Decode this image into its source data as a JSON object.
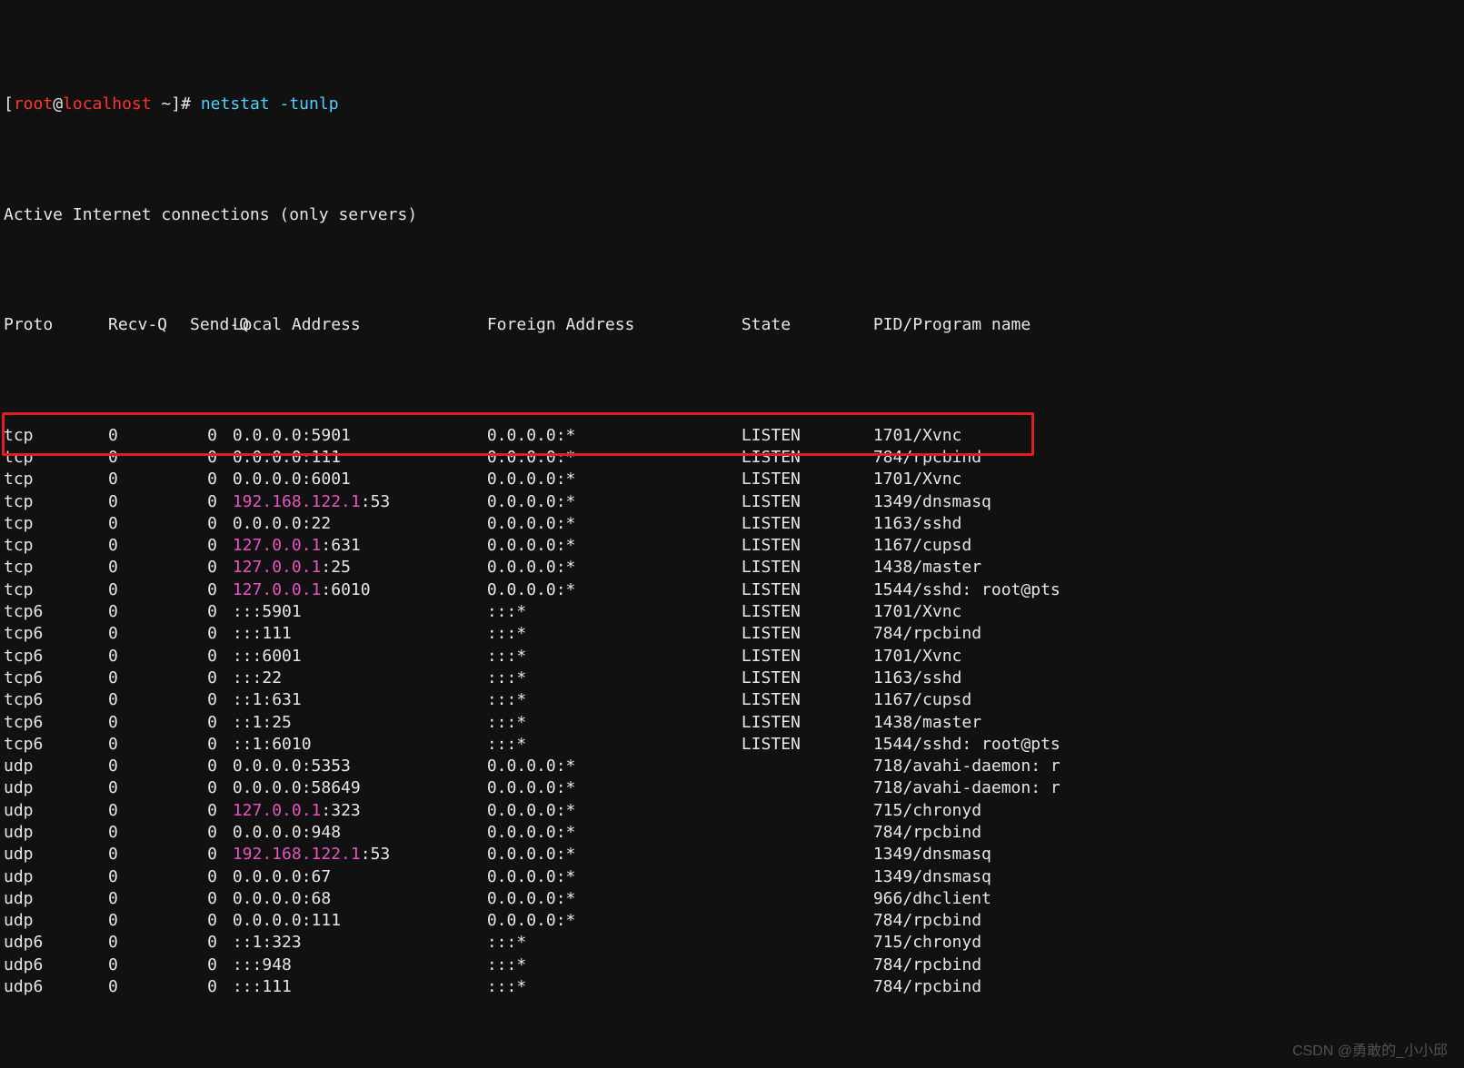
{
  "prompt": {
    "open": "[",
    "user": "root",
    "at": "@",
    "host": "localhost",
    "path": " ~",
    "close": "]#",
    "command": "netstat -tunlp"
  },
  "title_line": "Active Internet connections (only servers)",
  "headers": {
    "proto": "Proto",
    "recvq": "Recv-Q",
    "sendq": "Send-Q",
    "local": "Local Address",
    "foreign": "Foreign Address",
    "state": "State",
    "pid": "PID/Program name"
  },
  "rows": [
    {
      "proto": "tcp",
      "recvq": "0",
      "sendq": "0",
      "local_pre": "",
      "local_hi": "",
      "local_post": "0.0.0.0:5901",
      "foreign": "0.0.0.0:*",
      "state": "LISTEN",
      "pid": "1701/Xvnc",
      "hl": true
    },
    {
      "proto": "tcp",
      "recvq": "0",
      "sendq": "0",
      "local_pre": "",
      "local_hi": "",
      "local_post": "0.0.0.0:111",
      "foreign": "0.0.0.0:*",
      "state": "LISTEN",
      "pid": "784/rpcbind"
    },
    {
      "proto": "tcp",
      "recvq": "0",
      "sendq": "0",
      "local_pre": "",
      "local_hi": "",
      "local_post": "0.0.0.0:6001",
      "foreign": "0.0.0.0:*",
      "state": "LISTEN",
      "pid": "1701/Xvnc"
    },
    {
      "proto": "tcp",
      "recvq": "0",
      "sendq": "0",
      "local_pre": "",
      "local_hi": "192.168.122.1",
      "local_post": ":53",
      "foreign": "0.0.0.0:*",
      "state": "LISTEN",
      "pid": "1349/dnsmasq"
    },
    {
      "proto": "tcp",
      "recvq": "0",
      "sendq": "0",
      "local_pre": "",
      "local_hi": "",
      "local_post": "0.0.0.0:22",
      "foreign": "0.0.0.0:*",
      "state": "LISTEN",
      "pid": "1163/sshd"
    },
    {
      "proto": "tcp",
      "recvq": "0",
      "sendq": "0",
      "local_pre": "",
      "local_hi": "127.0.0.1",
      "local_post": ":631",
      "foreign": "0.0.0.0:*",
      "state": "LISTEN",
      "pid": "1167/cupsd"
    },
    {
      "proto": "tcp",
      "recvq": "0",
      "sendq": "0",
      "local_pre": "",
      "local_hi": "127.0.0.1",
      "local_post": ":25",
      "foreign": "0.0.0.0:*",
      "state": "LISTEN",
      "pid": "1438/master"
    },
    {
      "proto": "tcp",
      "recvq": "0",
      "sendq": "0",
      "local_pre": "",
      "local_hi": "127.0.0.1",
      "local_post": ":6010",
      "foreign": "0.0.0.0:*",
      "state": "LISTEN",
      "pid": "1544/sshd: root@pts"
    },
    {
      "proto": "tcp6",
      "recvq": "0",
      "sendq": "0",
      "local_pre": "",
      "local_hi": "",
      "local_post": ":::5901",
      "foreign": ":::*",
      "state": "LISTEN",
      "pid": "1701/Xvnc"
    },
    {
      "proto": "tcp6",
      "recvq": "0",
      "sendq": "0",
      "local_pre": "",
      "local_hi": "",
      "local_post": ":::111",
      "foreign": ":::*",
      "state": "LISTEN",
      "pid": "784/rpcbind"
    },
    {
      "proto": "tcp6",
      "recvq": "0",
      "sendq": "0",
      "local_pre": "",
      "local_hi": "",
      "local_post": ":::6001",
      "foreign": ":::*",
      "state": "LISTEN",
      "pid": "1701/Xvnc"
    },
    {
      "proto": "tcp6",
      "recvq": "0",
      "sendq": "0",
      "local_pre": "",
      "local_hi": "",
      "local_post": ":::22",
      "foreign": ":::*",
      "state": "LISTEN",
      "pid": "1163/sshd"
    },
    {
      "proto": "tcp6",
      "recvq": "0",
      "sendq": "0",
      "local_pre": "",
      "local_hi": "",
      "local_post": "::1:631",
      "foreign": ":::*",
      "state": "LISTEN",
      "pid": "1167/cupsd"
    },
    {
      "proto": "tcp6",
      "recvq": "0",
      "sendq": "0",
      "local_pre": "",
      "local_hi": "",
      "local_post": "::1:25",
      "foreign": ":::*",
      "state": "LISTEN",
      "pid": "1438/master"
    },
    {
      "proto": "tcp6",
      "recvq": "0",
      "sendq": "0",
      "local_pre": "",
      "local_hi": "",
      "local_post": "::1:6010",
      "foreign": ":::*",
      "state": "LISTEN",
      "pid": "1544/sshd: root@pts"
    },
    {
      "proto": "udp",
      "recvq": "0",
      "sendq": "0",
      "local_pre": "",
      "local_hi": "",
      "local_post": "0.0.0.0:5353",
      "foreign": "0.0.0.0:*",
      "state": "",
      "pid": "718/avahi-daemon: r"
    },
    {
      "proto": "udp",
      "recvq": "0",
      "sendq": "0",
      "local_pre": "",
      "local_hi": "",
      "local_post": "0.0.0.0:58649",
      "foreign": "0.0.0.0:*",
      "state": "",
      "pid": "718/avahi-daemon: r"
    },
    {
      "proto": "udp",
      "recvq": "0",
      "sendq": "0",
      "local_pre": "",
      "local_hi": "127.0.0.1",
      "local_post": ":323",
      "foreign": "0.0.0.0:*",
      "state": "",
      "pid": "715/chronyd"
    },
    {
      "proto": "udp",
      "recvq": "0",
      "sendq": "0",
      "local_pre": "",
      "local_hi": "",
      "local_post": "0.0.0.0:948",
      "foreign": "0.0.0.0:*",
      "state": "",
      "pid": "784/rpcbind"
    },
    {
      "proto": "udp",
      "recvq": "0",
      "sendq": "0",
      "local_pre": "",
      "local_hi": "192.168.122.1",
      "local_post": ":53",
      "foreign": "0.0.0.0:*",
      "state": "",
      "pid": "1349/dnsmasq"
    },
    {
      "proto": "udp",
      "recvq": "0",
      "sendq": "0",
      "local_pre": "",
      "local_hi": "",
      "local_post": "0.0.0.0:67",
      "foreign": "0.0.0.0:*",
      "state": "",
      "pid": "1349/dnsmasq"
    },
    {
      "proto": "udp",
      "recvq": "0",
      "sendq": "0",
      "local_pre": "",
      "local_hi": "",
      "local_post": "0.0.0.0:68",
      "foreign": "0.0.0.0:*",
      "state": "",
      "pid": "966/dhclient"
    },
    {
      "proto": "udp",
      "recvq": "0",
      "sendq": "0",
      "local_pre": "",
      "local_hi": "",
      "local_post": "0.0.0.0:111",
      "foreign": "0.0.0.0:*",
      "state": "",
      "pid": "784/rpcbind"
    },
    {
      "proto": "udp6",
      "recvq": "0",
      "sendq": "0",
      "local_pre": "",
      "local_hi": "",
      "local_post": "::1:323",
      "foreign": ":::*",
      "state": "",
      "pid": "715/chronyd"
    },
    {
      "proto": "udp6",
      "recvq": "0",
      "sendq": "0",
      "local_pre": "",
      "local_hi": "",
      "local_post": ":::948",
      "foreign": ":::*",
      "state": "",
      "pid": "784/rpcbind"
    },
    {
      "proto": "udp6",
      "recvq": "0",
      "sendq": "0",
      "local_pre": "",
      "local_hi": "",
      "local_post": ":::111",
      "foreign": ":::*",
      "state": "",
      "pid": "784/rpcbind"
    }
  ],
  "watermark": "CSDN @勇敢的_小小邱"
}
